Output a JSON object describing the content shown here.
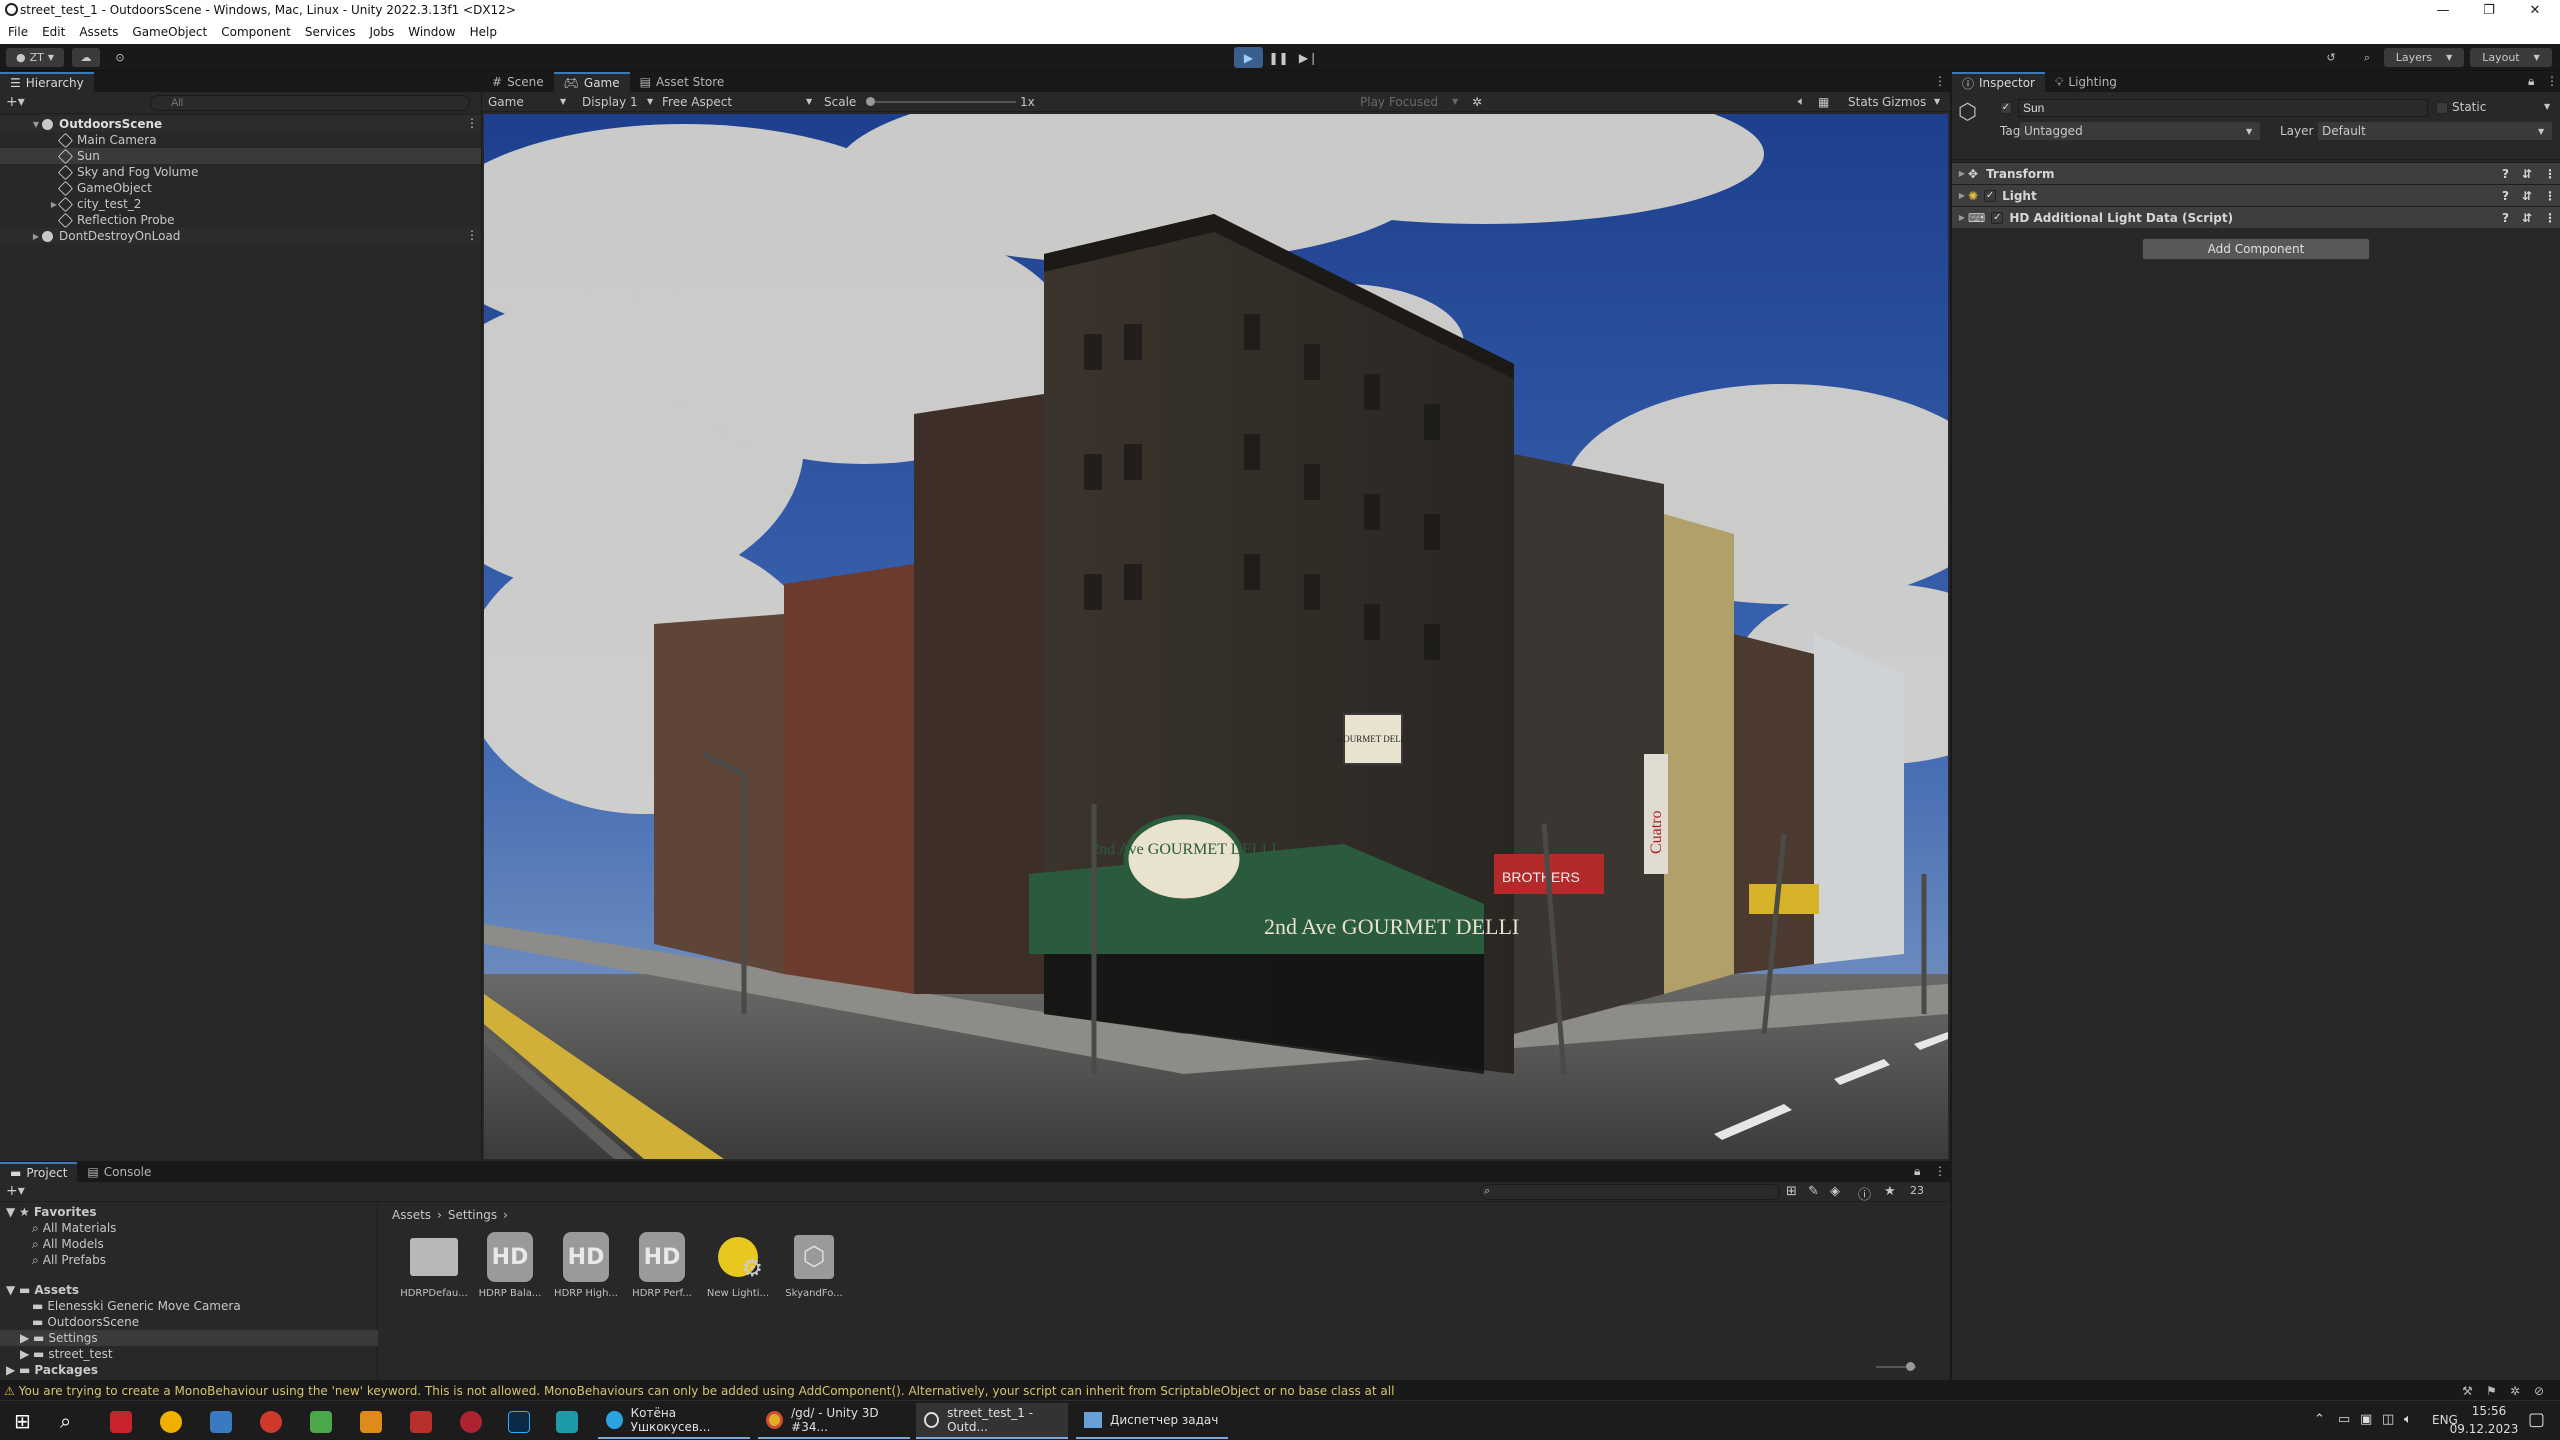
{
  "window": {
    "title": "street_test_1 - OutdoorsScene - Windows, Mac, Linux - Unity 2022.3.13f1 <DX12>"
  },
  "menu": [
    "File",
    "Edit",
    "Assets",
    "GameObject",
    "Component",
    "Services",
    "Jobs",
    "Window",
    "Help"
  ],
  "toolbar": {
    "account": "ZT",
    "layers": "Layers",
    "layout": "Layout"
  },
  "hierarchy": {
    "tab": "Hierarchy",
    "search_placeholder": "All",
    "items": [
      {
        "label": "OutdoorsScene"
      },
      {
        "label": "Main Camera"
      },
      {
        "label": "Sun"
      },
      {
        "label": "Sky and Fog Volume"
      },
      {
        "label": "GameObject"
      },
      {
        "label": "city_test_2"
      },
      {
        "label": "Reflection Probe"
      },
      {
        "label": "DontDestroyOnLoad"
      }
    ]
  },
  "game": {
    "tabs": [
      "Scene",
      "Game",
      "Asset Store"
    ],
    "view_mode": "Game",
    "display": "Display 1",
    "aspect": "Free Aspect",
    "scale_label": "Scale",
    "scale_value": "1x",
    "play_mode": "Play Focused",
    "stats": "Stats",
    "gizmos": "Gizmos",
    "signs": {
      "awning": "2nd Ave GOURMET DELLI",
      "oval": "2nd Ave GOURMET DELLI",
      "hanging": "GOURMET DELLI",
      "brothers": "BROTHERS",
      "cuatro": "Cuatro"
    }
  },
  "inspector": {
    "tabs": [
      "Inspector",
      "Lighting"
    ],
    "object_name": "Sun",
    "static": "Static",
    "tag_label": "Tag",
    "tag_value": "Untagged",
    "layer_label": "Layer",
    "layer_value": "Default",
    "components": [
      "Transform",
      "Light",
      "HD Additional Light Data (Script)"
    ],
    "add_component": "Add Component"
  },
  "project": {
    "tabs": [
      "Project",
      "Console"
    ],
    "tree": [
      {
        "label": "Favorites",
        "bold": true
      },
      {
        "label": "All Materials"
      },
      {
        "label": "All Models"
      },
      {
        "label": "All Prefabs"
      },
      {
        "label": "Assets",
        "bold": true
      },
      {
        "label": "Elenesski Generic Move Camera"
      },
      {
        "label": "OutdoorsScene"
      },
      {
        "label": "Settings"
      },
      {
        "label": "street_test"
      },
      {
        "label": "Packages",
        "bold": true
      }
    ],
    "breadcrumb": [
      "Assets",
      "Settings"
    ],
    "count": "23",
    "assets": [
      {
        "label": "HDRPDefau...",
        "icon": "folder-icon"
      },
      {
        "label": "HDRP Bala...",
        "icon": "hd-icon"
      },
      {
        "label": "HDRP High...",
        "icon": "hd-icon"
      },
      {
        "label": "HDRP Perf...",
        "icon": "hd-icon"
      },
      {
        "label": "New Lighti...",
        "icon": "lighting-settings-icon"
      },
      {
        "label": "SkyandFo...",
        "icon": "volume-profile-icon"
      }
    ]
  },
  "status": {
    "message": "You are trying to create a MonoBehaviour using the 'new' keyword.  This is not allowed.  MonoBehaviours can only be added using AddComponent(). Alternatively, your script can inherit from ScriptableObject or no base class at all"
  },
  "taskbar": {
    "apps": [
      "Котёна Ушкокусев...",
      "/gd/ - Unity 3D #34...",
      "street_test_1 - Outd...",
      "Диспетчер задач"
    ],
    "lang": "ENG",
    "time": "15:56",
    "date": "09.12.2023"
  }
}
